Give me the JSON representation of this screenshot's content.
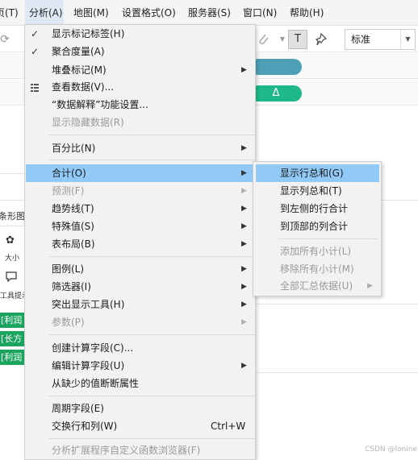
{
  "menubar": {
    "items": [
      {
        "label": "页(T)"
      },
      {
        "label": "分析(A)"
      },
      {
        "label": "地图(M)"
      },
      {
        "label": "设置格式(O)"
      },
      {
        "label": "服务器(S)"
      },
      {
        "label": "窗口(N)"
      },
      {
        "label": "帮助(H)"
      }
    ]
  },
  "toolbar": {
    "t_label": "T",
    "font_select": "标准"
  },
  "shelves": {
    "pill_delta": "Δ"
  },
  "left_panel": {
    "bar_label": "条形图",
    "size_label": "大小",
    "tooltip_label": "工具提示",
    "pills": [
      "[利润",
      "[长方",
      "[利润"
    ]
  },
  "menu": {
    "items": [
      {
        "label": "显示标记标签(H)",
        "checked": true
      },
      {
        "label": "聚合度量(A)",
        "checked": true
      },
      {
        "label": "堆叠标记(M)"
      },
      {
        "label": "查看数据(V)..."
      },
      {
        "label": "“数据解释”功能设置..."
      },
      {
        "label": "显示隐藏数据(R)",
        "disabled": true
      },
      {
        "label": "百分比(N)"
      },
      {
        "label": "合计(O)",
        "highlighted": true
      },
      {
        "label": "预测(F)",
        "disabled": true
      },
      {
        "label": "趋势线(T)"
      },
      {
        "label": "特殊值(S)"
      },
      {
        "label": "表布局(B)"
      },
      {
        "label": "图例(L)"
      },
      {
        "label": "筛选器(I)"
      },
      {
        "label": "突出显示工具(H)"
      },
      {
        "label": "参数(P)",
        "disabled": true
      },
      {
        "label": "创建计算字段(C)..."
      },
      {
        "label": "编辑计算字段(U)"
      },
      {
        "label": "从缺少的值断断属性"
      },
      {
        "label": "周期字段(E)"
      },
      {
        "label": "交换行和列(W)",
        "shortcut": "Ctrl+W"
      },
      {
        "label": "分析扩展程序自定义函数浏览器(F)",
        "disabled": true
      }
    ]
  },
  "submenu": {
    "items": [
      {
        "label": "显示行总和(G)",
        "highlighted": true
      },
      {
        "label": "显示列总和(T)"
      },
      {
        "label": "到左侧的行合计"
      },
      {
        "label": "到顶部的列合计"
      },
      {
        "label": "添加所有小计(L)",
        "disabled": true
      },
      {
        "label": "移除所有小计(M)",
        "disabled": true
      },
      {
        "label": "全部汇总依据(U)",
        "disabled": true
      }
    ]
  },
  "watermark": "CSDN @lonine"
}
